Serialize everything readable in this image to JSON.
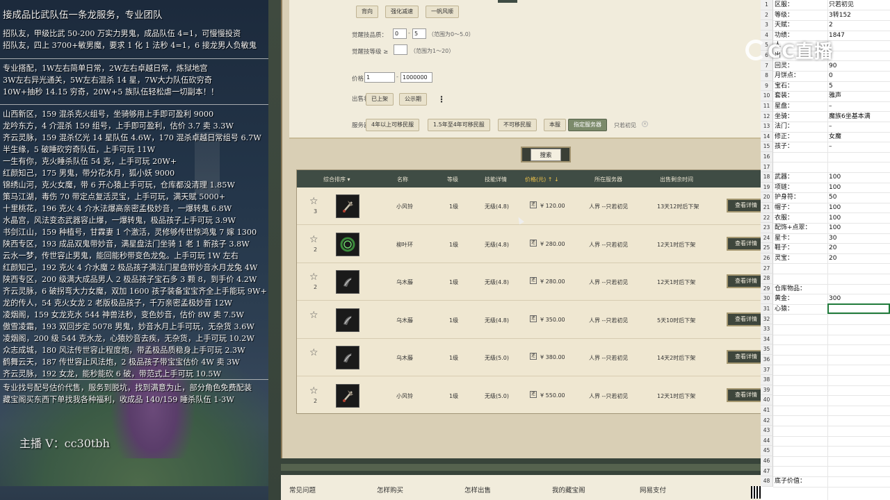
{
  "left_panel": {
    "title": "接成品比武队伍一条龙服务，专业团队",
    "recruit": [
      "招队友，甲级比武 50-200 万实力男鬼，成品队伍 4=1，可慢慢投资",
      "招队友，四上 3700+敏男魔，要求 1 化 1 法秒 4=1，6 接龙男人负敏鬼"
    ],
    "services": [
      "专业搭配，1W左右简单日常，2W左右卓越日常，炼狱地宫",
      "3W左右异光通关，5W左右混杀 14 星，7W大力队伍砍穷奇",
      "10W+抽秒 14.15 穷奇，20W+5 族队伍轻松虐一切副本！！"
    ],
    "listings": [
      "山西新区，159 混杀克火组号，坐骑够用上手即可盈利 9000",
      "龙吟东方，4 介混杀 159 组号，上手即可盈利，估价 3.7 卖 3.3W",
      "齐云灵脉，159 混杀亿光 14 星队伍 4.6W，170 混杀卓越日常组号 6.7W",
      "半生缘，5 破睡砍穷奇队伍，上手可玩 11W",
      "一生有你，克火睡杀队伍 54 克，上手可玩 20W+",
      "红颜知己，175 男鬼，带分花水月，狐小妖 9000",
      "锦绣山河，克火女魔，带 6 开心猿上手可玩，仓库都没清理 1.85W",
      "策马江湖，毒伤 70 带定点复活灵宝，上手可玩，满天赋 5000+",
      "十里桃花，196 克火 4 介水法爆高亲密孟极妙音，一爆转鬼 6.8W",
      "水晶宫，风法变态武器容止爆，一爆转鬼，极品孩子上手可玩 3.9W",
      "书剑江山，159 种植号，甘霖妻 1 个激活，灵修够传世惊鸿鬼 7 嫁 1300",
      "陕西专区，193 成品双鬼带妙音，满星盘法门坐骑 1 老 1 新孩子 3.8W",
      "云水一梦，传世容止男鬼，能回能秒带变色龙兔。上手可玩 1W 左右",
      "红颜知己，192 克火 4 介水魔 2 极品孩子满法门星盘带妙音水月龙兔 4W",
      "陕西专区，200 级满大成品男人 2 极品孩子宝石多 3 颗 8，到手价 4.2W",
      "齐云灵脉，6 破拐弯大力女魔，双加 1600 孩子装备宝宝齐全上手能玩 9W+",
      "龙的传人，54 克火女龙 2 老版极品孩子，千万亲密孟极妙音 12W",
      "凌烟阁，159 女龙克水 544 神兽法秒，变色妙音，估价 8W 卖 7.5W",
      "傲雪凌霜，193 双回步定 5078 男鬼，妙音水月上手可玩，无杂货 3.6W",
      "凌烟阁，200 级 544 克水龙，心猿妙音去疾，无杂货，上手可玩 10.2W",
      "众志成城，180 风法传世容止程度炮，带孟极品质稳身上手可玩 2.3W",
      "鹤舞云天，187 传世容止风法炮，2 极品孩子带宝宝估价 4W 卖 3W",
      "齐云灵脉，192 女龙，能秒能砍 6 破，带范式上手可玩 10.5W"
    ],
    "footer": [
      "专业找号配号估价代售，服务到脱坑，找到满意为止，部分角色免费配装",
      "藏宝阁买东西下单找我各种福利，收成品 140/159 睡杀队伍 1-3W"
    ],
    "anchor": "主播 V：cc30tbh"
  },
  "filters": {
    "top_chips": [
      "背向",
      "强化减速",
      "一帆风顺"
    ],
    "awaken_quality_label": "觉醒技品质：",
    "awaken_quality_min": "0",
    "awaken_quality_max": "5",
    "awaken_quality_hint": "（范围为0～5.0）",
    "awaken_level_label": "觉醒技等级 ≥",
    "awaken_level_value": "",
    "awaken_level_hint": "（范围为1～20）",
    "price_label": "价格：",
    "price_min": "1",
    "price_max": "1000000",
    "status_label": "出售状态：",
    "status_chips": [
      "已上架",
      "公示期"
    ],
    "server_label": "服务器：",
    "server_chips": [
      "4年以上可移民服",
      "1.5年至4年可移民服",
      "不可移民服",
      "本服",
      "指定服务器"
    ],
    "server_selected": "只若初见",
    "search_label": "搜索"
  },
  "table": {
    "headers": [
      "综合排序",
      "名称",
      "等级",
      "技能详情",
      "价格(元)",
      "所在服务器",
      "出售剩余时间"
    ],
    "rows": [
      {
        "stars": "3",
        "name": "小风铃",
        "level": "1级",
        "skill": "无级(4.8)",
        "price": "¥ 120.00",
        "server": "人界 --只若初见",
        "time": "13天12时后下架",
        "btn": "查看详情",
        "icon": "bell-icon"
      },
      {
        "stars": "2",
        "name": "柳叶环",
        "level": "1级",
        "skill": "无级(4.8)",
        "price": "¥ 280.00",
        "server": "人界 --只若初见",
        "time": "12天1时后下架",
        "btn": "查看详情",
        "icon": "ring-icon"
      },
      {
        "stars": "2",
        "name": "乌木藤",
        "level": "1级",
        "skill": "无级(4.8)",
        "price": "¥ 280.00",
        "server": "人界 --只若初见",
        "time": "12天1时后下架",
        "btn": "查看详情",
        "icon": "vine-icon"
      },
      {
        "stars": "",
        "name": "乌木藤",
        "level": "1级",
        "skill": "无级(4.8)",
        "price": "¥ 350.00",
        "server": "人界 --只若初见",
        "time": "5天10时后下架",
        "btn": "查看详情",
        "icon": "vine-icon"
      },
      {
        "stars": "",
        "name": "乌木藤",
        "level": "1级",
        "skill": "无级(5.0)",
        "price": "¥ 380.00",
        "server": "人界 --只若初见",
        "time": "14天2时后下架",
        "btn": "查看详情",
        "icon": "vine-icon"
      },
      {
        "stars": "2",
        "name": "小风铃",
        "level": "1级",
        "skill": "无级(5.0)",
        "price": "¥ 550.00",
        "server": "人界 --只若初见",
        "time": "12天1时后下架",
        "btn": "查看详情",
        "icon": "bell-icon"
      }
    ]
  },
  "footer_nav": [
    "常见问题",
    "怎样购买",
    "怎样出售",
    "我的藏宝阁",
    "网易支付"
  ],
  "sheet": {
    "rows": [
      [
        "区服：",
        "只若初见"
      ],
      [
        "等级：",
        "3转152"
      ],
      [
        "天赋：",
        "2"
      ],
      [
        "功绩：",
        "1847"
      ],
      [
        "人",
        ""
      ],
      [
        "出",
        ""
      ],
      [
        "回灵：",
        "90"
      ],
      [
        "月饼点：",
        "0"
      ],
      [
        "宝石：",
        "5"
      ],
      [
        "套装：",
        "雅声"
      ],
      [
        "星盘：",
        "–"
      ],
      [
        "坐骑：",
        "魔族6坐基本满"
      ],
      [
        "法门：",
        "–"
      ],
      [
        "修正：",
        "女魔"
      ],
      [
        "孩子：",
        "–"
      ],
      [
        "",
        ""
      ],
      [
        "",
        ""
      ],
      [
        "武器：",
        "100"
      ],
      [
        "项链：",
        "100"
      ],
      [
        "护身符：",
        "50"
      ],
      [
        "帽子：",
        "100"
      ],
      [
        "衣服：",
        "100"
      ],
      [
        "配饰+点翠：",
        "100"
      ],
      [
        "星卡：",
        "30"
      ],
      [
        "鞋子：",
        "20"
      ],
      [
        "灵宝：",
        "20"
      ],
      [
        "",
        ""
      ],
      [
        "",
        ""
      ],
      [
        "仓库物品：",
        ""
      ],
      [
        "黄金：",
        "300"
      ],
      [
        "心猿：",
        ""
      ],
      [
        "",
        ""
      ],
      [
        "",
        ""
      ],
      [
        "",
        ""
      ],
      [
        "",
        ""
      ],
      [
        "",
        ""
      ],
      [
        "",
        ""
      ],
      [
        "",
        ""
      ],
      [
        "",
        ""
      ],
      [
        "",
        ""
      ],
      [
        "",
        ""
      ],
      [
        "",
        ""
      ],
      [
        "",
        ""
      ],
      [
        "",
        ""
      ],
      [
        "",
        ""
      ],
      [
        "",
        ""
      ],
      [
        "",
        ""
      ],
      [
        "底子价值：",
        ""
      ]
    ]
  },
  "logo_text": "CC直播",
  "colors": {
    "header_bg": "#3f4c44",
    "price_header": "#f0c44a",
    "selected_cell_border": "#1f7a3a"
  }
}
